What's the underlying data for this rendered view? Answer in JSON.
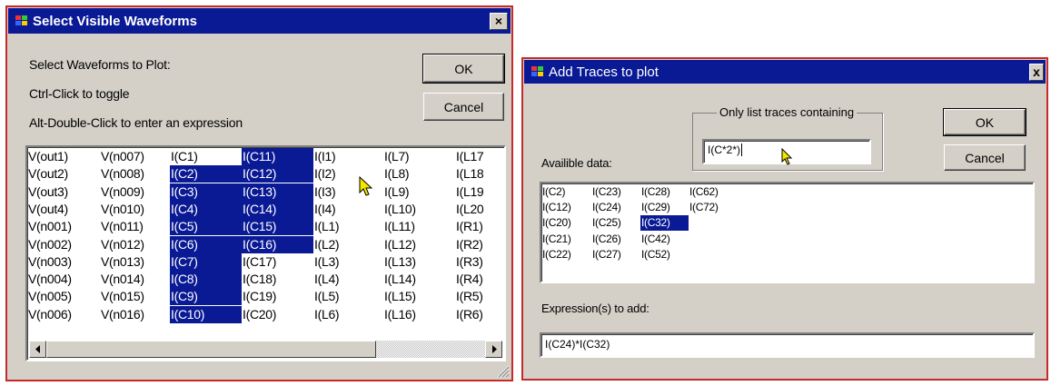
{
  "dialog1": {
    "title": "Select Visible Waveforms",
    "close_label": "×",
    "instructions": [
      "Select Waveforms to Plot:",
      "Ctrl-Click to toggle",
      "Alt-Double-Click to enter an expression"
    ],
    "ok_label": "OK",
    "cancel_label": "Cancel",
    "columns": [
      [
        "V(out1)",
        "V(out2)",
        "V(out3)",
        "V(out4)",
        "V(n001)",
        "V(n002)",
        "V(n003)",
        "V(n004)",
        "V(n005)",
        "V(n006)"
      ],
      [
        "V(n007)",
        "V(n008)",
        "V(n009)",
        "V(n010)",
        "V(n011)",
        "V(n012)",
        "V(n013)",
        "V(n014)",
        "V(n015)",
        "V(n016)"
      ],
      [
        "I(C1)",
        "I(C2)",
        "I(C3)",
        "I(C4)",
        "I(C5)",
        "I(C6)",
        "I(C7)",
        "I(C8)",
        "I(C9)",
        "I(C10)"
      ],
      [
        "I(C11)",
        "I(C12)",
        "I(C13)",
        "I(C14)",
        "I(C15)",
        "I(C16)",
        "I(C17)",
        "I(C18)",
        "I(C19)",
        "I(C20)"
      ],
      [
        "I(I1)",
        "I(I2)",
        "I(I3)",
        "I(I4)",
        "I(L1)",
        "I(L2)",
        "I(L3)",
        "I(L4)",
        "I(L5)",
        "I(L6)"
      ],
      [
        "I(L7)",
        "I(L8)",
        "I(L9)",
        "I(L10)",
        "I(L11)",
        "I(L12)",
        "I(L13)",
        "I(L14)",
        "I(L15)",
        "I(L16)"
      ],
      [
        "I(L17",
        "I(L18",
        "I(L19",
        "I(L20",
        "I(R1)",
        "I(R2)",
        "I(R3)",
        "I(R4)",
        "I(R5)",
        "I(R6)"
      ]
    ],
    "selected": [
      [],
      [],
      [
        1,
        2,
        3,
        4,
        5,
        6,
        7,
        8,
        9
      ],
      [
        0,
        1,
        2,
        3,
        4,
        5
      ],
      [],
      [],
      []
    ],
    "scroll_left_icon": "left-arrow-icon",
    "scroll_right_icon": "right-arrow-icon"
  },
  "dialog2": {
    "title": "Add Traces to plot",
    "close_label": "x",
    "filter_label": "Only list traces containing",
    "filter_value": "I(C*2*)",
    "available_label": "Availible data:",
    "ok_label": "OK",
    "cancel_label": "Cancel",
    "columns": [
      [
        "I(C2)",
        "I(C12)",
        "I(C20)",
        "I(C21)",
        "I(C22)"
      ],
      [
        "I(C23)",
        "I(C24)",
        "I(C25)",
        "I(C26)",
        "I(C27)"
      ],
      [
        "I(C28)",
        "I(C29)",
        "I(C32)",
        "I(C42)",
        "I(C52)"
      ],
      [
        "I(C62)",
        "I(C72)"
      ]
    ],
    "selected": [
      [],
      [],
      [
        2
      ],
      []
    ],
    "expression_label": "Expression(s) to add:",
    "expression_value": "I(C24)*I(C32)"
  },
  "colors": {
    "titlebar": "#0a1a94",
    "selection": "#0a1a94",
    "dialog_face": "#d4d0c8",
    "window_border": "#c62a2a",
    "cursor": "#f5e600"
  },
  "icons": [
    "app-icon",
    "close-icon",
    "mouse-cursor-icon",
    "size-grip-icon"
  ]
}
